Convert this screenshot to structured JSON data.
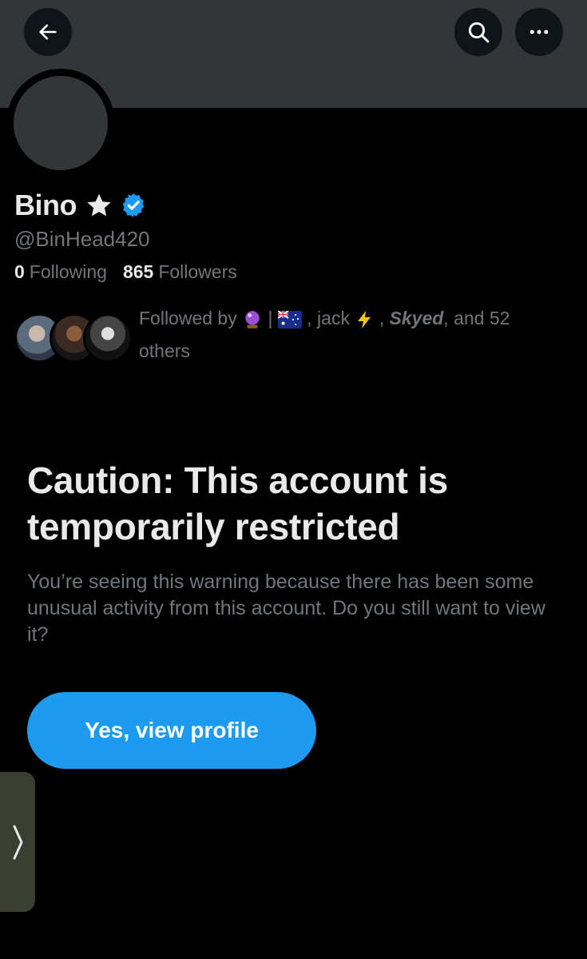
{
  "header": {
    "back_icon": "arrow-left-icon",
    "search_icon": "search-icon",
    "more_icon": "ellipsis-icon"
  },
  "profile": {
    "display_name": "Bino",
    "name_suffix_icon": "star-icon",
    "verified_icon": "verified-badge-icon",
    "handle": "@BinHead420",
    "following_count": "0",
    "following_label": "Following",
    "followers_count": "865",
    "followers_label": "Followers"
  },
  "followed_by": {
    "prefix": "Followed by",
    "separator": "|",
    "names": [
      ", jack",
      ", ",
      "Skyed",
      ", and 52 others"
    ]
  },
  "warning": {
    "title": "Caution: This account is temporarily restricted",
    "body": "You’re seeing this warning because there has been some unusual activity from this account. Do you still want to view it?",
    "button_label": "Yes, view profile"
  },
  "colors": {
    "accent": "#1d9bf0",
    "background": "#000000",
    "banner": "#333639",
    "secondary_text": "#71767b"
  }
}
